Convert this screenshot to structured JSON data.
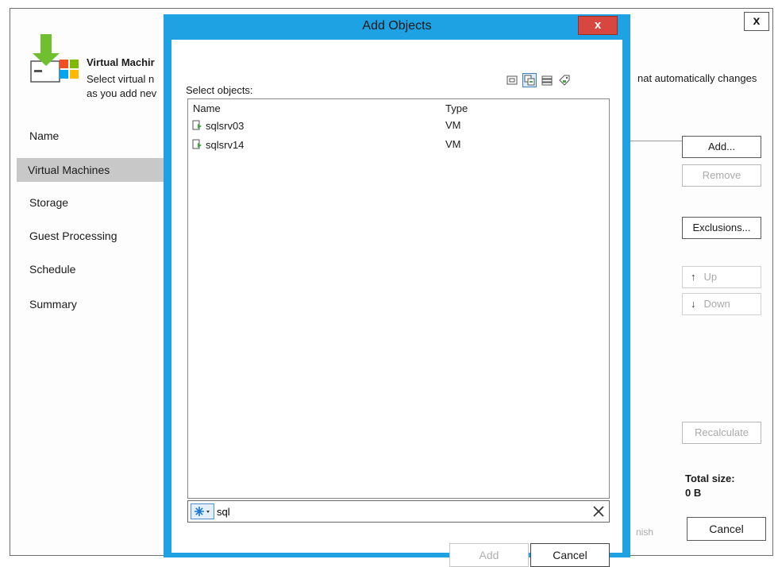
{
  "wizard": {
    "close_label": "x",
    "title": "Virtual Machir",
    "description_line1": "Select virtual n",
    "description_line2": "as you add nev",
    "description_right": "nat automatically changes",
    "nav": [
      {
        "label": "Name"
      },
      {
        "label": "Virtual Machines"
      },
      {
        "label": "Storage"
      },
      {
        "label": "Guest Processing"
      },
      {
        "label": "Schedule"
      },
      {
        "label": "Summary"
      }
    ],
    "buttons": {
      "add": "Add...",
      "remove": "Remove",
      "exclusions": "Exclusions...",
      "up": "Up",
      "down": "Down",
      "recalculate": "Recalculate",
      "finish": "nish",
      "cancel": "Cancel"
    },
    "total_size_label": "Total size:",
    "total_size_value": "0 B"
  },
  "dialog": {
    "title": "Add Objects",
    "close_label": "x",
    "select_label": "Select objects:",
    "columns": {
      "name": "Name",
      "type": "Type"
    },
    "rows": [
      {
        "name": "sqlsrv03",
        "type": "VM"
      },
      {
        "name": "sqlsrv14",
        "type": "VM"
      }
    ],
    "search": {
      "value": "sql"
    },
    "buttons": {
      "add": "Add",
      "cancel": "Cancel"
    },
    "accent_color": "#1ea2e4",
    "close_color": "#d8473f"
  }
}
